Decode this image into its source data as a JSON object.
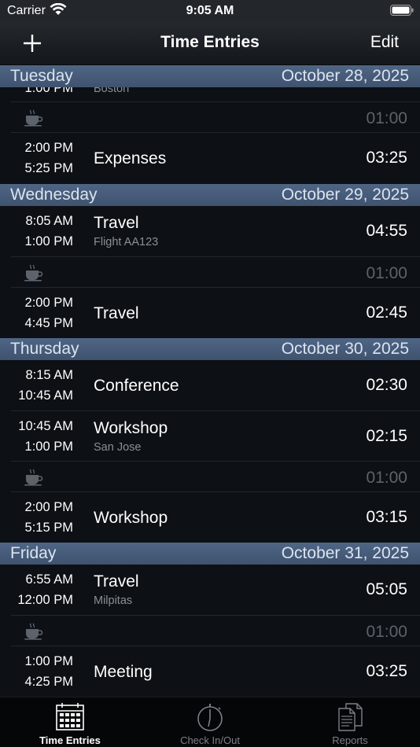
{
  "status": {
    "carrier": "Carrier",
    "time": "9:05 AM"
  },
  "nav": {
    "title": "Time Entries",
    "edit": "Edit"
  },
  "partial": {
    "time": "1:00 PM",
    "location": "Boston"
  },
  "days": [
    {
      "day": "Tuesday",
      "date": "October 28, 2025",
      "entries": [
        {
          "type": "break",
          "duration": "01:00"
        },
        {
          "type": "entry",
          "start": "2:00 PM",
          "end": "5:25 PM",
          "activity": "Expenses",
          "location": "",
          "duration": "03:25"
        }
      ]
    },
    {
      "day": "Wednesday",
      "date": "October 29, 2025",
      "entries": [
        {
          "type": "entry",
          "start": "8:05 AM",
          "end": "1:00 PM",
          "activity": "Travel",
          "location": "Flight AA123",
          "duration": "04:55"
        },
        {
          "type": "break",
          "duration": "01:00"
        },
        {
          "type": "entry",
          "start": "2:00 PM",
          "end": "4:45 PM",
          "activity": "Travel",
          "location": "",
          "duration": "02:45"
        }
      ]
    },
    {
      "day": "Thursday",
      "date": "October 30, 2025",
      "entries": [
        {
          "type": "entry",
          "start": "8:15 AM",
          "end": "10:45 AM",
          "activity": "Conference",
          "location": "",
          "duration": "02:30"
        },
        {
          "type": "entry",
          "start": "10:45 AM",
          "end": "1:00 PM",
          "activity": "Workshop",
          "location": "San Jose",
          "duration": "02:15"
        },
        {
          "type": "break",
          "duration": "01:00"
        },
        {
          "type": "entry",
          "start": "2:00 PM",
          "end": "5:15 PM",
          "activity": "Workshop",
          "location": "",
          "duration": "03:15"
        }
      ]
    },
    {
      "day": "Friday",
      "date": "October 31, 2025",
      "entries": [
        {
          "type": "entry",
          "start": "6:55 AM",
          "end": "12:00 PM",
          "activity": "Travel",
          "location": "Milpitas",
          "duration": "05:05"
        },
        {
          "type": "break",
          "duration": "01:00"
        },
        {
          "type": "entry",
          "start": "1:00 PM",
          "end": "4:25 PM",
          "activity": "Meeting",
          "location": "",
          "duration": "03:25"
        }
      ]
    }
  ],
  "tabs": [
    {
      "label": "Time Entries",
      "icon": "calendar-icon",
      "active": true
    },
    {
      "label": "Check In/Out",
      "icon": "stopwatch-icon",
      "active": false
    },
    {
      "label": "Reports",
      "icon": "documents-icon",
      "active": false
    }
  ],
  "colors": {
    "header": "#4a5f7e",
    "background": "#0d1014",
    "muted": "#5d636b"
  }
}
